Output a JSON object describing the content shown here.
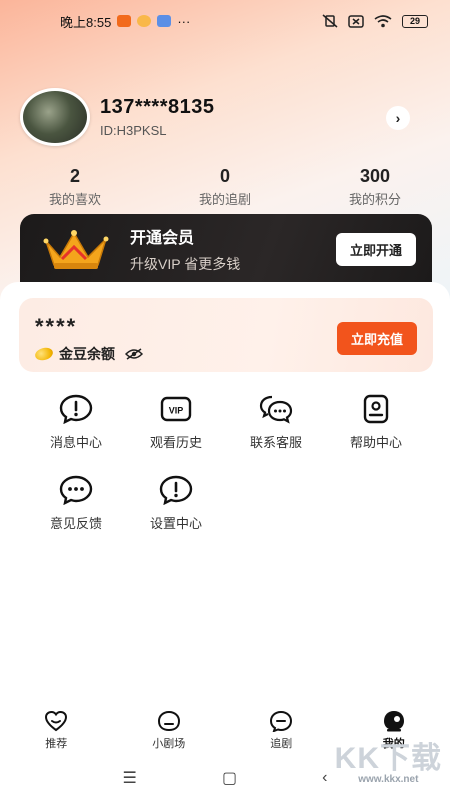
{
  "status_bar": {
    "time": "晚上8:55",
    "battery": "29"
  },
  "profile": {
    "phone": "137****8135",
    "user_id": "ID:H3PKSL"
  },
  "stats": [
    {
      "value": "2",
      "label": "我的喜欢"
    },
    {
      "value": "0",
      "label": "我的追剧"
    },
    {
      "value": "300",
      "label": "我的积分"
    }
  ],
  "vip": {
    "title": "开通会员",
    "subtitle": "升级VIP 省更多钱",
    "button": "立即开通"
  },
  "wallet": {
    "balance_masked": "****",
    "label": "金豆余额",
    "button": "立即充值"
  },
  "grid_items": [
    {
      "label": "消息中心",
      "icon": "message-alert-icon"
    },
    {
      "label": "观看历史",
      "icon": "vip-history-icon"
    },
    {
      "label": "联系客服",
      "icon": "chat-bubbles-icon"
    },
    {
      "label": "帮助中心",
      "icon": "help-card-icon"
    },
    {
      "label": "意见反馈",
      "icon": "feedback-dots-icon"
    },
    {
      "label": "设置中心",
      "icon": "settings-alert-icon"
    }
  ],
  "tabs": [
    {
      "label": "推荐",
      "icon": "heart-icon"
    },
    {
      "label": "小剧场",
      "icon": "theater-icon"
    },
    {
      "label": "追剧",
      "icon": "follow-icon"
    },
    {
      "label": "我的",
      "icon": "profile-icon"
    }
  ],
  "watermark": {
    "main": "KK下载",
    "sub": "www.kkx.net"
  },
  "colors": {
    "accent": "#f2541c",
    "vip_bg": "#1c1a1a",
    "wallet_bg": "#fdece4"
  }
}
